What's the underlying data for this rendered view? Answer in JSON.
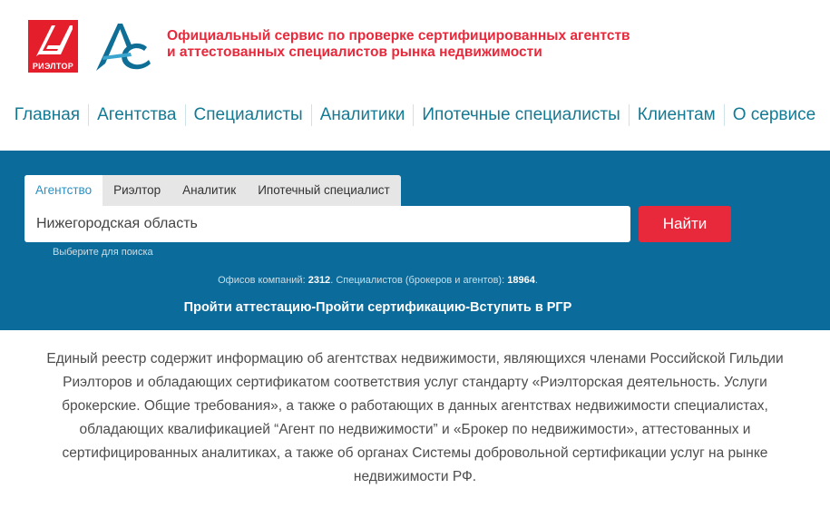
{
  "header": {
    "realtor_logo_text": "РИЭЛТОР",
    "tagline_line1": "Официальный сервис по проверке сертифицированных агентств",
    "tagline_line2": "и аттестованных специалистов рынка недвижимости"
  },
  "colors": {
    "brand_red": "#e41e2b",
    "band_blue": "#0b6b9a",
    "nav_teal": "#137a94"
  },
  "nav": {
    "items": [
      "Главная",
      "Агентства",
      "Специалисты",
      "Аналитики",
      "Ипотечные специалисты",
      "Клиентам",
      "О сервисе"
    ]
  },
  "search": {
    "tabs": [
      "Агентство",
      "Риэлтор",
      "Аналитик",
      "Ипотечный специалист"
    ],
    "active_tab": "Агентство",
    "input_value": "Нижегородская область",
    "button_label": "Найти",
    "hint": "Выберите для поиска"
  },
  "stats": {
    "offices_label": "Офисов компаний:",
    "offices_value": "2312",
    "specialists_label": "Специалистов (брокеров и агентов):",
    "specialists_value": "18964"
  },
  "cta": "Пройти аттестацию-Пройти сертификацию-Вступить в РГР",
  "description": "Единый реестр содержит информацию об агентствах недвижимости, являющихся членами Российской Гильдии Риэлторов и обладающих сертификатом соответствия услуг стандарту «Риэлторская деятельность. Услуги брокерские. Общие требования», а также о работающих в данных агентствах недвижимости специалистах, обладающих квалификацией “Агент по недвижимости” и «Брокер по недвижимости», аттестованных и сертифицированных аналитиках, а также об органах Системы добровольной сертификации услуг на рынке недвижимости РФ."
}
